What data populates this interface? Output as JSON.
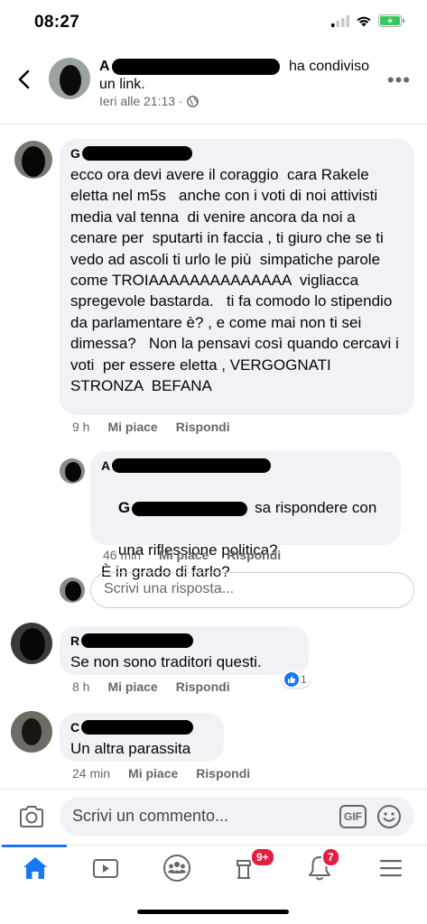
{
  "status_bar": {
    "time": "08:27"
  },
  "header": {
    "author_initial": "A",
    "shared_text": "ha condiviso",
    "shared_text_2": "un link.",
    "timestamp": "Ieri alle 21:13 ·"
  },
  "comments": [
    {
      "name_initial": "G",
      "text": "ecco ora devi avere il coraggio  cara Rakele eletta nel m5s   anche con i voti di noi attivisti  media val tenna  di venire ancora da noi a cenare per  sputarti in faccia , ti giuro che se ti vedo ad ascoli ti urlo le più  simpatiche parole  come TROIAAAAAAAAAAAAAA  vigliacca spregevole bastarda.   ti fa comodo lo stipendio da parlamentare è? , e come mai non ti sei dimessa?   Non la pensavi così quando cercavi i voti  per essere eletta , VERGOGNATI  STRONZA  BEFANA",
      "time": "9 h",
      "like": "Mi piace",
      "reply": "Rispondi"
    },
    {
      "name_initial": "A",
      "mention_initial": "G",
      "text_line1": "sa rispondere con",
      "text_rest": "una riflessione politica?\nÈ in grado di farlo?",
      "time": "46 min",
      "like": "Mi piace",
      "reply": "Rispondi"
    },
    {
      "name_initial": "R",
      "text": "Se non sono traditori questi.",
      "time": "8 h",
      "like": "Mi piace",
      "reply": "Rispondi",
      "reaction_count": "1"
    },
    {
      "name_initial": "C",
      "text": "Un altra parassita",
      "time": "24 min",
      "like": "Mi piace",
      "reply": "Rispondi"
    }
  ],
  "reply_placeholder": "Scrivi una risposta...",
  "composer": {
    "placeholder": "Scrivi un commento...",
    "gif_label": "GIF"
  },
  "tabbar": {
    "feed_badge": "9+",
    "notifications_badge": "7",
    "accent_color": "#1877f2",
    "badge_color": "#e41e3f"
  }
}
